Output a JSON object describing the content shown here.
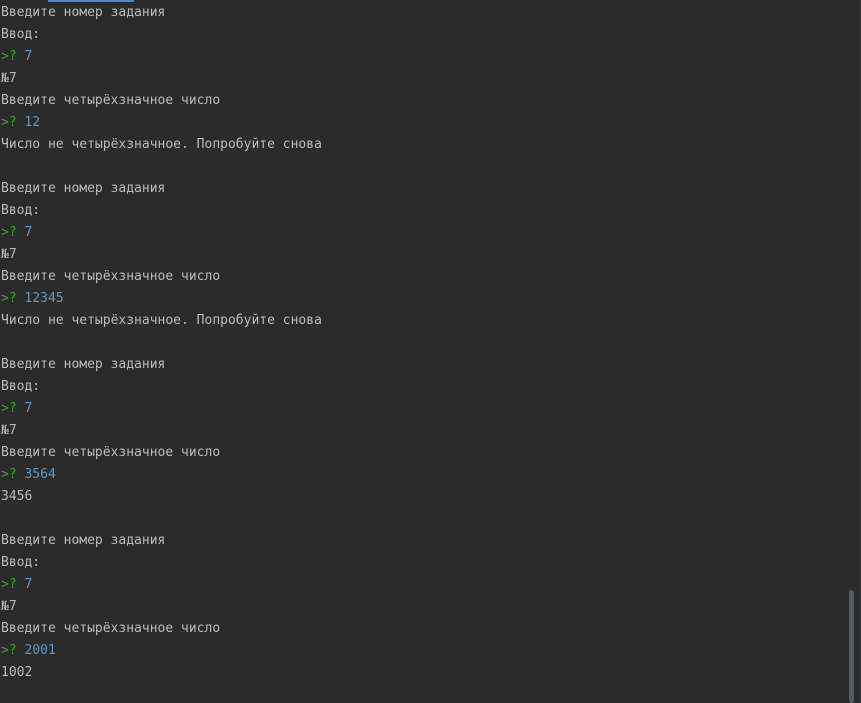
{
  "console": {
    "lines": [
      {
        "kind": "text",
        "text": "Введите номер задания"
      },
      {
        "kind": "text",
        "text": "Ввод:"
      },
      {
        "kind": "input",
        "marker": ">?",
        "value": "7"
      },
      {
        "kind": "text",
        "text": "№7"
      },
      {
        "kind": "text",
        "text": "Введите четырёхзначное число"
      },
      {
        "kind": "input",
        "marker": ">?",
        "value": "12"
      },
      {
        "kind": "text",
        "text": "Число не четырёхзначное. Попробуйте снова"
      },
      {
        "kind": "text",
        "text": ""
      },
      {
        "kind": "text",
        "text": "Введите номер задания"
      },
      {
        "kind": "text",
        "text": "Ввод:"
      },
      {
        "kind": "input",
        "marker": ">?",
        "value": "7"
      },
      {
        "kind": "text",
        "text": "№7"
      },
      {
        "kind": "text",
        "text": "Введите четырёхзначное число"
      },
      {
        "kind": "input",
        "marker": ">?",
        "value": "12345"
      },
      {
        "kind": "text",
        "text": "Число не четырёхзначное. Попробуйте снова"
      },
      {
        "kind": "text",
        "text": ""
      },
      {
        "kind": "text",
        "text": "Введите номер задания"
      },
      {
        "kind": "text",
        "text": "Ввод:"
      },
      {
        "kind": "input",
        "marker": ">?",
        "value": "7"
      },
      {
        "kind": "text",
        "text": "№7"
      },
      {
        "kind": "text",
        "text": "Введите четырёхзначное число"
      },
      {
        "kind": "input",
        "marker": ">?",
        "value": "3564"
      },
      {
        "kind": "text",
        "text": "3456"
      },
      {
        "kind": "text",
        "text": ""
      },
      {
        "kind": "text",
        "text": "Введите номер задания"
      },
      {
        "kind": "text",
        "text": "Ввод:"
      },
      {
        "kind": "input",
        "marker": ">?",
        "value": "7"
      },
      {
        "kind": "text",
        "text": "№7"
      },
      {
        "kind": "text",
        "text": "Введите четырёхзначное число"
      },
      {
        "kind": "input",
        "marker": ">?",
        "value": "2001"
      },
      {
        "kind": "text",
        "text": "1002"
      }
    ]
  },
  "colors": {
    "background": "#2b2b2b",
    "text": "#bbbbbb",
    "prompt_marker": "#3fa336",
    "input_value": "#6897bb",
    "scrollbar_thumb": "#585b5e"
  }
}
